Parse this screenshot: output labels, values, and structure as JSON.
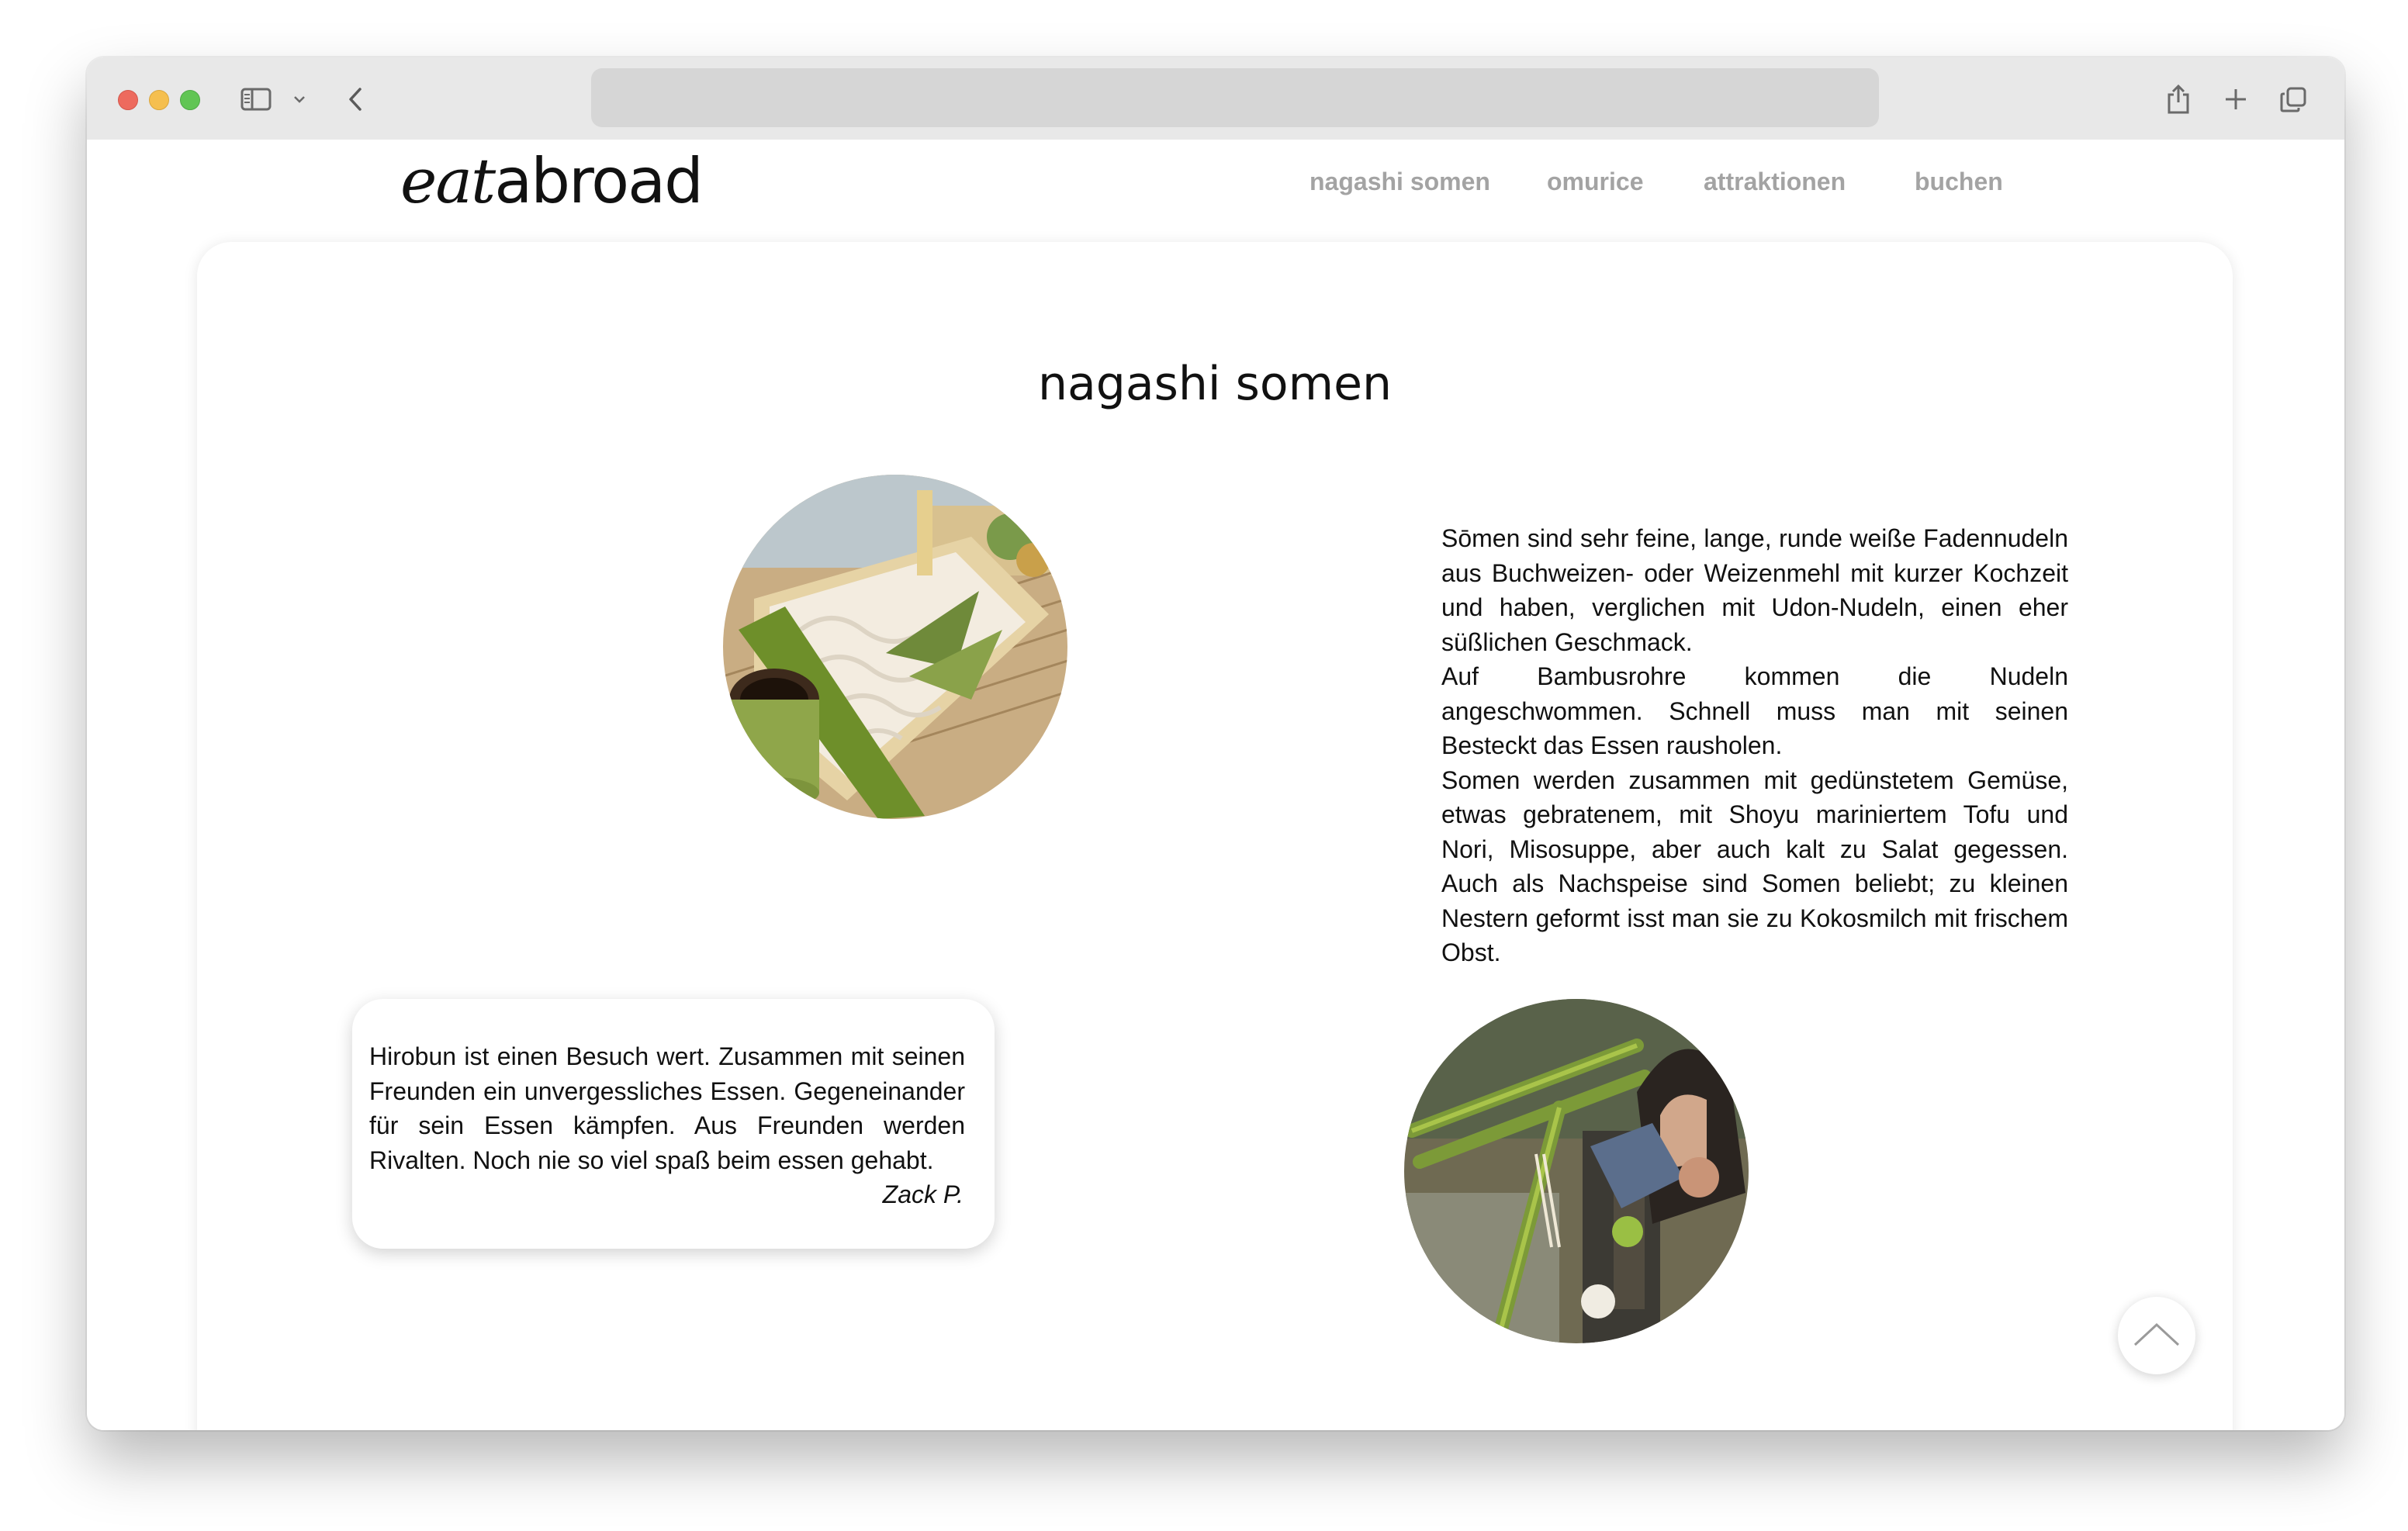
{
  "browser": {
    "icons": [
      "sidebar-icon",
      "chevron-down-icon",
      "back-icon",
      "share-icon",
      "new-tab-icon",
      "tabs-overview-icon"
    ]
  },
  "site": {
    "logo_part1": "eat",
    "logo_part2": "abroad",
    "nav": [
      "nagashi somen",
      "omurice",
      "attraktionen",
      "buchen"
    ]
  },
  "main": {
    "title": "nagashi somen",
    "description": [
      "Sōmen sind sehr feine, lange, runde weiße Fadennudeln aus Buchweizen- oder Weizenmehl mit kurzer Kochzeit und haben, verglichen mit Udon-Nudeln, einen eher süßlichen Geschmack.",
      "Auf Bambusrohre kommen die Nudeln angeschwommen. Schnell muss man mit seinen Besteckt das Essen rausholen.",
      "Somen werden zusammen mit gedünstetem Gemüse, etwas gebratenem, mit Shoyu mariniertem Tofu und Nori, Misosuppe, aber auch kalt zu Salat gegessen. Auch als Nachspeise sind Somen beliebt; zu kleinen Nestern geformt isst man sie zu Kokosmilch mit frischem Obst."
    ],
    "review": {
      "text": "Hirobun ist einen Besuch wert. Zusammen mit seinen Freunden ein unvergessliches Essen. Gegeneinander für sein Essen kämpfen. Aus Freunden werden Rivalten. Noch nie so viel spaß beim essen gehabt.",
      "author": "Zack P."
    },
    "images": [
      "somen-dish-photo",
      "bamboo-flume-dining-photo"
    ],
    "scroll_top_icon": "chevron-up-icon"
  }
}
